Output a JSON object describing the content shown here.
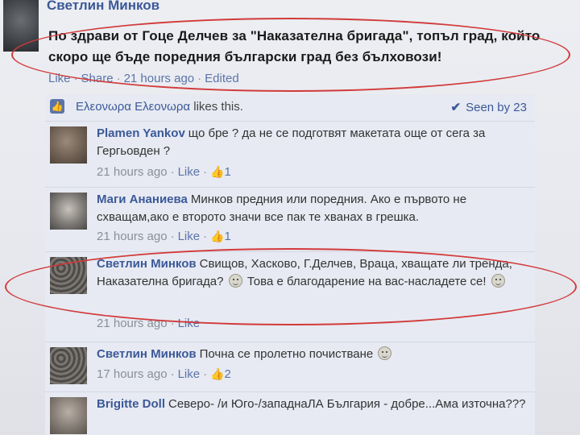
{
  "post": {
    "author": "Светлин Минков",
    "text": "По здрави от Гоце Делчев за \"Наказателна бригада\", топъл град, който скоро ще бъде поредния български град без бълховози!",
    "like_label": "Like",
    "share_label": "Share",
    "time": "21 hours ago",
    "edited": "Edited",
    "dot": "·"
  },
  "likes": {
    "name": "Ελεονωρα Ελεονωρα",
    "text": "likes this.",
    "seen_label": "Seen by 23"
  },
  "comments": [
    {
      "author": "Plamen Yankov",
      "text": "що бре ? да не се подготвят макетата още от сега за Гергьовден ?",
      "time": "21 hours ago",
      "like_label": "Like",
      "likes": "1"
    },
    {
      "author": "Маги Ананиева",
      "text": "Минков предния или поредния. Ако е първото не схващам,ако е второто значи все пак те хванах в грешка.",
      "time": "21 hours ago",
      "like_label": "Like",
      "likes": "1"
    },
    {
      "author": "Светлин Минков",
      "text_a": "Свищов, Хасково, Г.Делчев, Враца, хващате ли тренда, Наказателна бригада?",
      "text_b": "Това е благодарение на вас-насладете се!",
      "time": "21 hours ago",
      "like_label": "Like"
    },
    {
      "author": "Светлин Минков",
      "text": "Почна се пролетно почистване",
      "time": "17 hours ago",
      "like_label": "Like",
      "likes": "2"
    },
    {
      "author": "Brigitte Doll",
      "text": "Северо- /и Юго-/западнаЛА България - добре...Ама източна???"
    }
  ],
  "icons": {
    "thumb": "thumbs-up-icon",
    "check": "check-icon",
    "smiley": "smiley-icon"
  },
  "colors": {
    "link": "#3b5998",
    "annotation": "#d23a3a"
  }
}
